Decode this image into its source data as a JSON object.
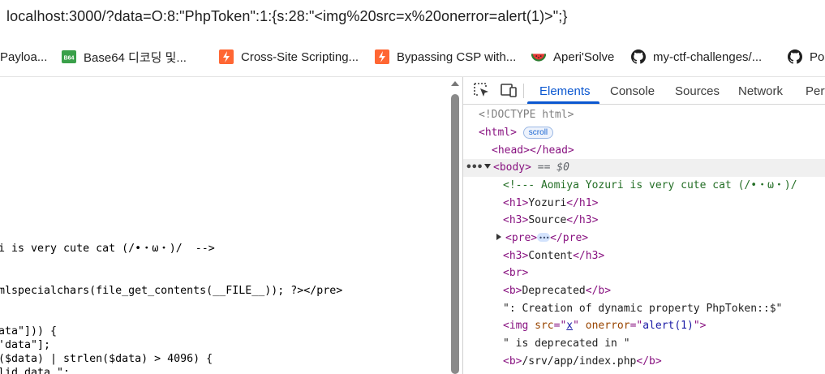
{
  "address_bar": {
    "url": "localhost:3000/?data=O:8:\"PhpToken\":1:{s:28:\"<img%20src=x%20onerror=alert(1)>\";}"
  },
  "bookmarks": [
    {
      "label": "Payloa...",
      "icon": "bookmark-icon"
    },
    {
      "label": "Base64 디코딩 및...",
      "icon": "b64-icon",
      "badge": "B64"
    },
    {
      "label": "Cross-Site Scripting...",
      "icon": "portswigger-icon"
    },
    {
      "label": "Bypassing CSP with...",
      "icon": "portswigger-icon"
    },
    {
      "label": "Aperi'Solve",
      "icon": "watermelon-icon"
    },
    {
      "label": "my-ctf-challenges/...",
      "icon": "github-icon"
    },
    {
      "label": "Pos",
      "icon": "github-icon"
    }
  ],
  "page_source_lines": [
    "i is very cute cat (/•・ω・)/  -->",
    "mlspecialchars(file_get_contents(__FILE__)); ?></pre>",
    "ata\"])) {",
    "'data\"];",
    "($data) | strlen($data) > 4096) {",
    "lid data.\";"
  ],
  "devtools": {
    "tabs": [
      "Elements",
      "Console",
      "Sources",
      "Network",
      "Perf"
    ],
    "active_tab": "Elements",
    "tree": {
      "doctype": "<!DOCTYPE html>",
      "html_open": "<html>",
      "scroll_badge": "scroll",
      "head": "<head></head>",
      "body_open": "<body>",
      "body_eq": "== $0",
      "comment": "<!--- Aomiya Yozuri is very cute cat (/•・ω・)/",
      "h1_open": "<h1>",
      "h1_text": "Yozuri",
      "h1_close": "</h1>",
      "h3_source_open": "<h3>",
      "h3_source_text": "Source",
      "h3_source_close": "</h3>",
      "pre_open": "<pre>",
      "pre_close": "</pre>",
      "h3_content_open": "<h3>",
      "h3_content_text": "Content",
      "h3_content_close": "</h3>",
      "br": "<br>",
      "b_open": "<b>",
      "b_text": "Deprecated",
      "b_close": "</b>",
      "text1": "\": Creation of dynamic property PhpToken::$\"",
      "img_tag": "<img",
      "img_src_attr": "src",
      "img_src_val": "x",
      "img_onerror_attr": "onerror",
      "img_onerror_val": "alert(1)",
      "img_end": ">",
      "text2": "\" is deprecated in \"",
      "b2_open": "<b>",
      "b2_text": "/srv/app/index.php",
      "b2_close": "</b>"
    }
  },
  "colors": {
    "tag": "#881280",
    "attr_name": "#994500",
    "attr_value": "#1a1aa6",
    "comment": "#236e25",
    "active_tab": "#0b57d0"
  }
}
